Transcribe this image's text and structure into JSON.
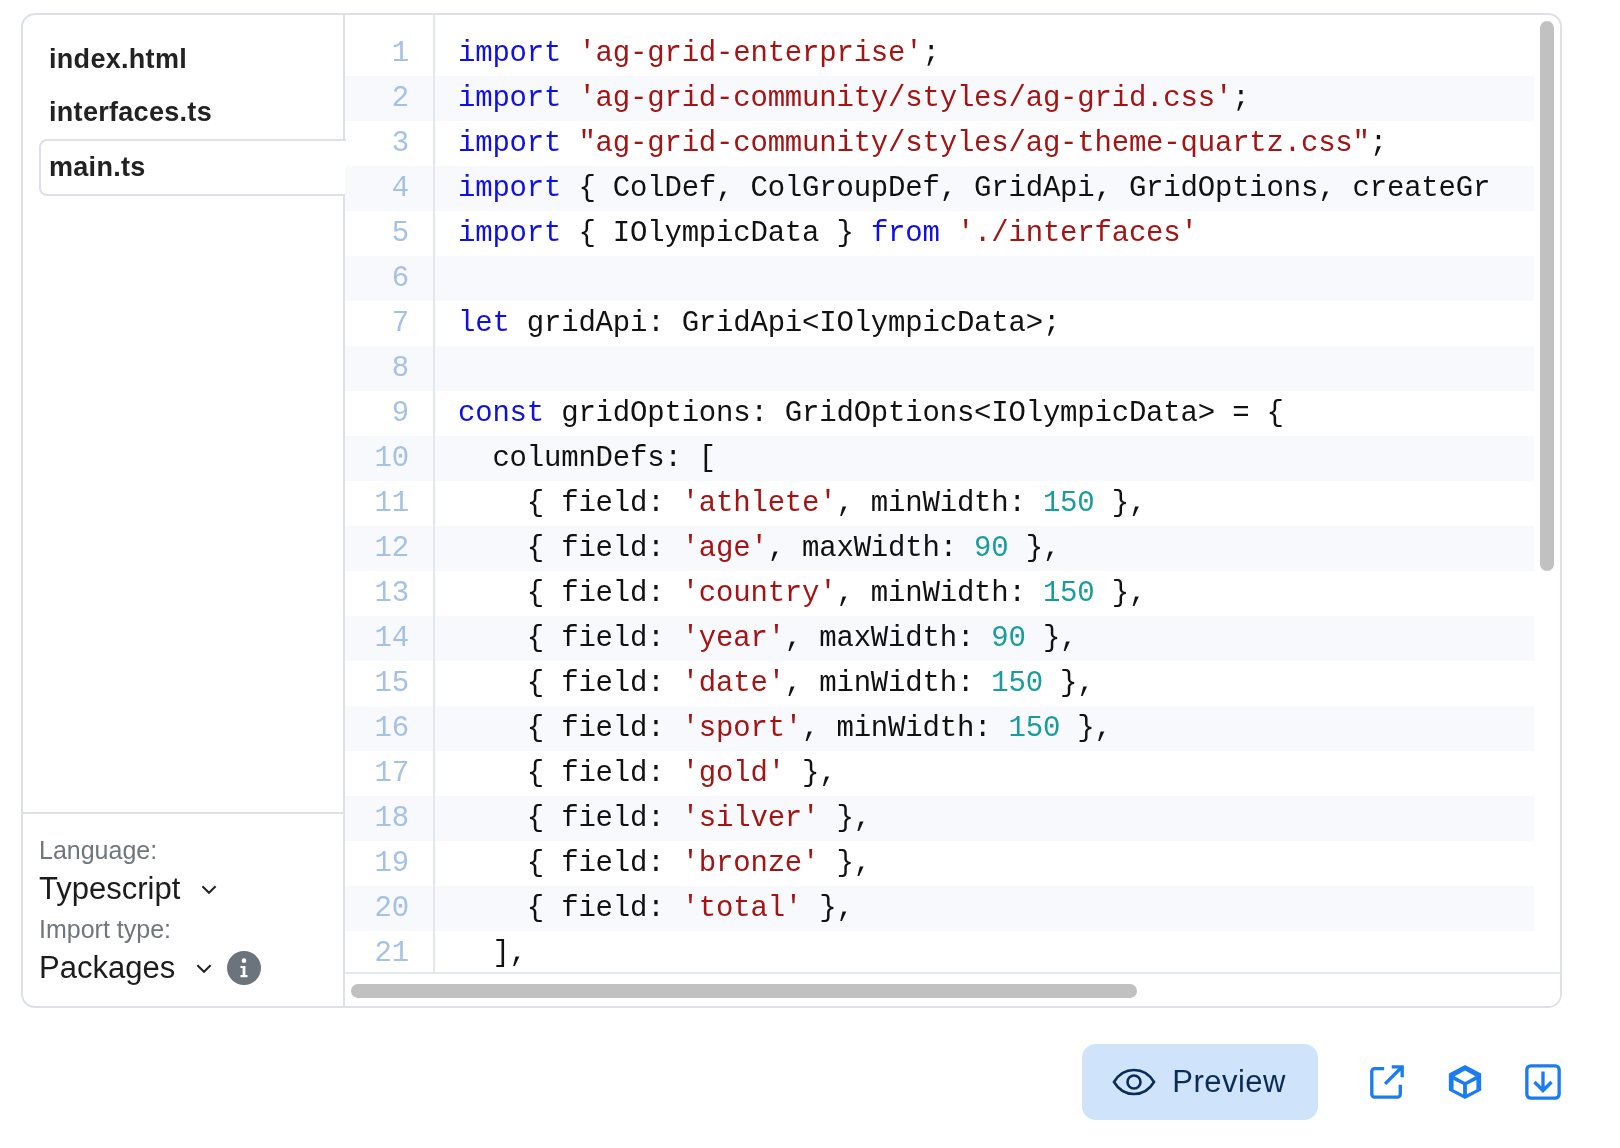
{
  "files": [
    {
      "name": "index.html",
      "selected": false
    },
    {
      "name": "interfaces.ts",
      "selected": false
    },
    {
      "name": "main.ts",
      "selected": true
    }
  ],
  "settings": [
    {
      "label": "Language:",
      "value": "Typescript",
      "info": false
    },
    {
      "label": "Import type:",
      "value": "Packages",
      "info": true
    }
  ],
  "code": [
    {
      "number": "1",
      "tokens": [
        {
          "kind": "keyword",
          "text": "import"
        },
        {
          "kind": "string",
          "text": " 'ag-grid-enterprise'"
        },
        {
          "kind": "plain",
          "text": ";"
        }
      ]
    },
    {
      "number": "2",
      "tokens": [
        {
          "kind": "keyword",
          "text": "import"
        },
        {
          "kind": "string",
          "text": " 'ag-grid-community/styles/ag-grid.css'"
        },
        {
          "kind": "plain",
          "text": ";"
        }
      ]
    },
    {
      "number": "3",
      "tokens": [
        {
          "kind": "keyword",
          "text": "import"
        },
        {
          "kind": "string",
          "text": " \"ag-grid-community/styles/ag-theme-quartz.css\""
        },
        {
          "kind": "plain",
          "text": ";"
        }
      ]
    },
    {
      "number": "4",
      "tokens": [
        {
          "kind": "keyword",
          "text": "import"
        },
        {
          "kind": "plain",
          "text": " { ColDef, ColGroupDef, GridApi, GridOptions, createGr"
        }
      ]
    },
    {
      "number": "5",
      "tokens": [
        {
          "kind": "keyword",
          "text": "import"
        },
        {
          "kind": "plain",
          "text": " { IOlympicData } "
        },
        {
          "kind": "keyword",
          "text": "from"
        },
        {
          "kind": "string",
          "text": " './interfaces'"
        }
      ]
    },
    {
      "number": "6"
    },
    {
      "number": "7",
      "tokens": [
        {
          "kind": "keyword",
          "text": "let"
        },
        {
          "kind": "plain",
          "text": " gridApi: GridApi<IOlympicData>;"
        }
      ]
    },
    {
      "number": "8"
    },
    {
      "number": "9",
      "tokens": [
        {
          "kind": "keyword",
          "text": "const"
        },
        {
          "kind": "plain",
          "text": " gridOptions: GridOptions<IOlympicData> = {"
        }
      ]
    },
    {
      "number": "10",
      "tokens": [
        {
          "kind": "plain",
          "text": "  columnDefs: ["
        }
      ]
    },
    {
      "number": "11",
      "tokens": [
        {
          "kind": "plain",
          "text": "    { field: "
        },
        {
          "kind": "string",
          "text": "'athlete'"
        },
        {
          "kind": "plain",
          "text": ", minWidth: "
        },
        {
          "kind": "number",
          "text": "150"
        },
        {
          "kind": "plain",
          "text": " },"
        }
      ]
    },
    {
      "number": "12",
      "tokens": [
        {
          "kind": "plain",
          "text": "    { field: "
        },
        {
          "kind": "string",
          "text": "'age'"
        },
        {
          "kind": "plain",
          "text": ", maxWidth: "
        },
        {
          "kind": "number",
          "text": "90"
        },
        {
          "kind": "plain",
          "text": " },"
        }
      ]
    },
    {
      "number": "13",
      "tokens": [
        {
          "kind": "plain",
          "text": "    { field: "
        },
        {
          "kind": "string",
          "text": "'country'"
        },
        {
          "kind": "plain",
          "text": ", minWidth: "
        },
        {
          "kind": "number",
          "text": "150"
        },
        {
          "kind": "plain",
          "text": " },"
        }
      ]
    },
    {
      "number": "14",
      "tokens": [
        {
          "kind": "plain",
          "text": "    { field: "
        },
        {
          "kind": "string",
          "text": "'year'"
        },
        {
          "kind": "plain",
          "text": ", maxWidth: "
        },
        {
          "kind": "number",
          "text": "90"
        },
        {
          "kind": "plain",
          "text": " },"
        }
      ]
    },
    {
      "number": "15",
      "tokens": [
        {
          "kind": "plain",
          "text": "    { field: "
        },
        {
          "kind": "string",
          "text": "'date'"
        },
        {
          "kind": "plain",
          "text": ", minWidth: "
        },
        {
          "kind": "number",
          "text": "150"
        },
        {
          "kind": "plain",
          "text": " },"
        }
      ]
    },
    {
      "number": "16",
      "tokens": [
        {
          "kind": "plain",
          "text": "    { field: "
        },
        {
          "kind": "string",
          "text": "'sport'"
        },
        {
          "kind": "plain",
          "text": ", minWidth: "
        },
        {
          "kind": "number",
          "text": "150"
        },
        {
          "kind": "plain",
          "text": " },"
        }
      ]
    },
    {
      "number": "17",
      "tokens": [
        {
          "kind": "plain",
          "text": "    { field: "
        },
        {
          "kind": "string",
          "text": "'gold'"
        },
        {
          "kind": "plain",
          "text": " },"
        }
      ]
    },
    {
      "number": "18",
      "tokens": [
        {
          "kind": "plain",
          "text": "    { field: "
        },
        {
          "kind": "string",
          "text": "'silver'"
        },
        {
          "kind": "plain",
          "text": " },"
        }
      ]
    },
    {
      "number": "19",
      "tokens": [
        {
          "kind": "plain",
          "text": "    { field: "
        },
        {
          "kind": "string",
          "text": "'bronze'"
        },
        {
          "kind": "plain",
          "text": " },"
        }
      ]
    },
    {
      "number": "20",
      "tokens": [
        {
          "kind": "plain",
          "text": "    { field: "
        },
        {
          "kind": "string",
          "text": "'total'"
        },
        {
          "kind": "plain",
          "text": " },"
        }
      ]
    },
    {
      "number": "21",
      "tokens": [
        {
          "kind": "plain",
          "text": "  ],"
        }
      ]
    }
  ],
  "preview_button": "Preview"
}
